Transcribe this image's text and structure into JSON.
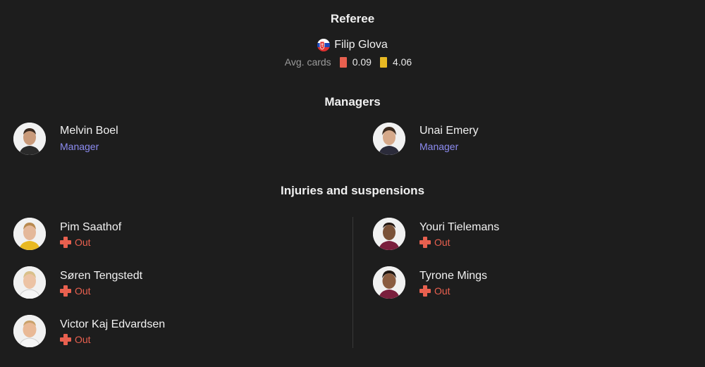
{
  "referee": {
    "title": "Referee",
    "name": "Filip Glova",
    "flag_icon": "slovakia-flag-icon",
    "avg_cards_label": "Avg. cards",
    "red_cards": "0.09",
    "yellow_cards": "4.06"
  },
  "managers": {
    "title": "Managers",
    "items": [
      {
        "name": "Melvin Boel",
        "role": "Manager"
      },
      {
        "name": "Unai Emery",
        "role": "Manager"
      }
    ]
  },
  "injuries": {
    "title": "Injuries and suspensions",
    "home": [
      {
        "name": "Pim Saathof",
        "status": "Out"
      },
      {
        "name": "Søren Tengstedt",
        "status": "Out"
      },
      {
        "name": "Victor Kaj Edvardsen",
        "status": "Out"
      }
    ],
    "away": [
      {
        "name": "Youri Tielemans",
        "status": "Out"
      },
      {
        "name": "Tyrone Mings",
        "status": "Out"
      }
    ]
  },
  "colors": {
    "background": "#1d1d1d",
    "accent_manager": "#8d8cf2",
    "status_out": "#e8604f",
    "yellow_card": "#e8b923"
  }
}
